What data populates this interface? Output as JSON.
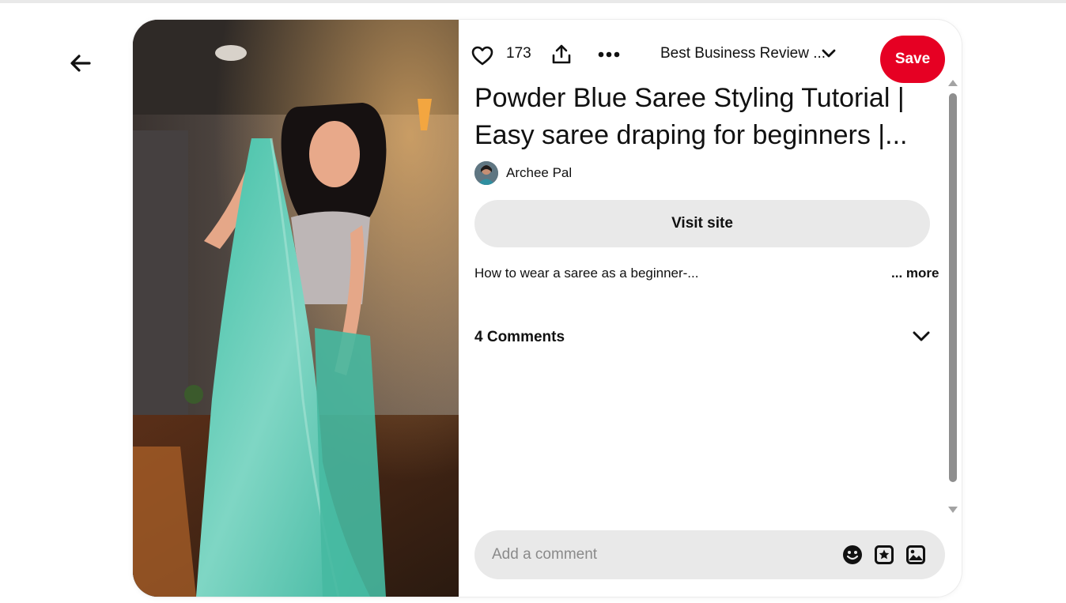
{
  "pin": {
    "reaction_count": "173",
    "board_name": "Best Business Review ...",
    "save_label": "Save",
    "title": "Powder Blue Saree Styling Tutorial | Easy saree draping for beginners |...",
    "author_name": "Archee Pal",
    "visit_label": "Visit site",
    "description": "How to wear a saree as a beginner-...",
    "more_label": "... more",
    "comments_label": "4 Comments",
    "comment_placeholder": "Add a comment"
  },
  "icons": {
    "back": "arrow-left-icon",
    "like": "heart-icon",
    "share": "share-icon",
    "more": "ellipsis-icon",
    "board_dropdown": "chevron-down-icon",
    "comments_toggle": "chevron-down-icon",
    "emoji": "emoji-icon",
    "sticker": "sticker-icon",
    "image": "image-icon"
  },
  "colors": {
    "save": "#e60023",
    "button_bg": "#e9e9e9",
    "scrollbar": "#8e8e8e"
  }
}
